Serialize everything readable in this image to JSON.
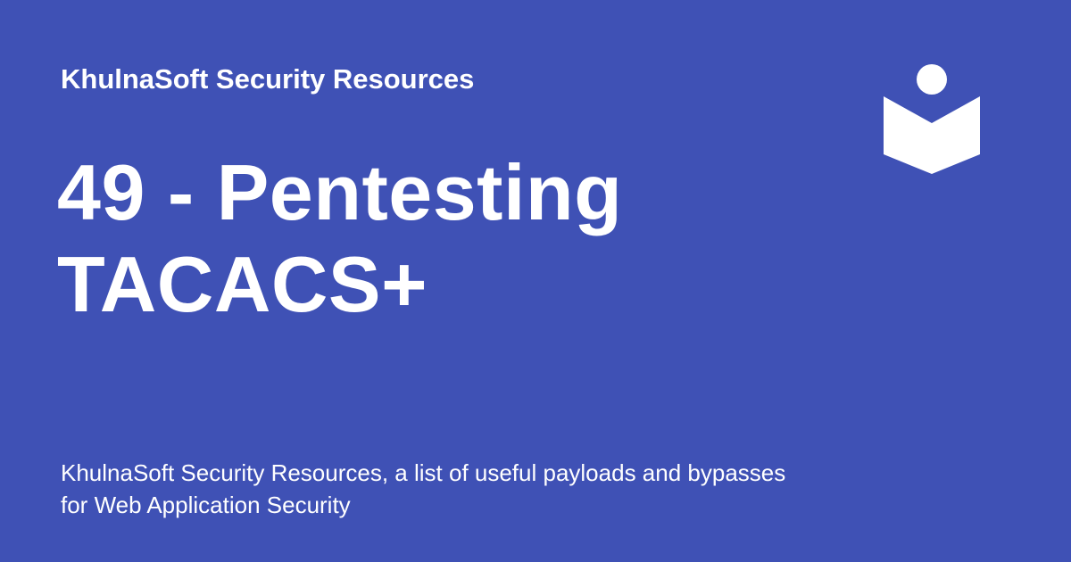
{
  "site": {
    "name": "KhulnaSoft Security Resources"
  },
  "page": {
    "title_line1": "49 - Pentesting",
    "title_line2": "TACACS+",
    "description": "KhulnaSoft Security Resources, a list of useful payloads and bypasses for Web Application Security"
  },
  "theme": {
    "background": "#3f51b5",
    "foreground": "#ffffff"
  },
  "logo": {
    "icon": "reader-book-icon"
  }
}
